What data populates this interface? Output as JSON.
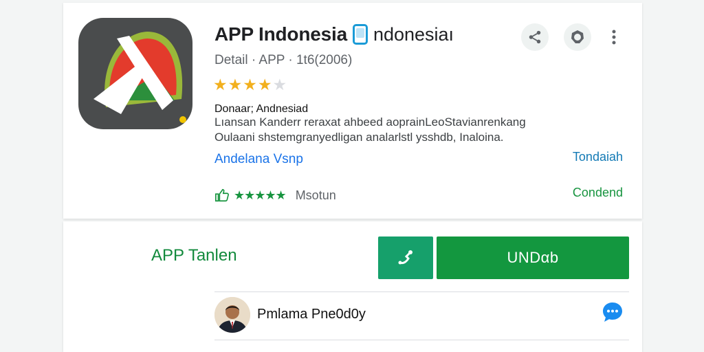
{
  "app": {
    "title": "APP Indonesia",
    "title_suffix": "ndonesiaı",
    "subtitle": "Detail · APP · 1t6(2006)",
    "rating_stars_filled": 4,
    "rating_stars_total": 5
  },
  "description": {
    "title": "Donaar; Andnesiad",
    "line1": "Lıansan Kanderr reraxat ahbeed aoprainLeoStavianrenkang",
    "line2": "Oulaani shstemgranyedligan analarlstl ysshdb, Inaloina."
  },
  "links": {
    "left": "Andelana   Vsnp",
    "right": "Tondaiah"
  },
  "reviews": {
    "stars": "★★★★★",
    "label": "Msotun",
    "right": "Condend"
  },
  "install": {
    "label": "APP Tanlen",
    "button_label": "UNDαb"
  },
  "developer": {
    "name": "Pmlama Pne0d0y"
  },
  "colors": {
    "accent_green": "#13973f",
    "teal_button": "#16a06b",
    "link_blue": "#1a73e8",
    "star_gold": "#f2b01e"
  },
  "icons": [
    "share-icon",
    "badge-icon",
    "more-vert-icon",
    "thumbs-up-icon",
    "phone-icon",
    "chat-icon"
  ]
}
